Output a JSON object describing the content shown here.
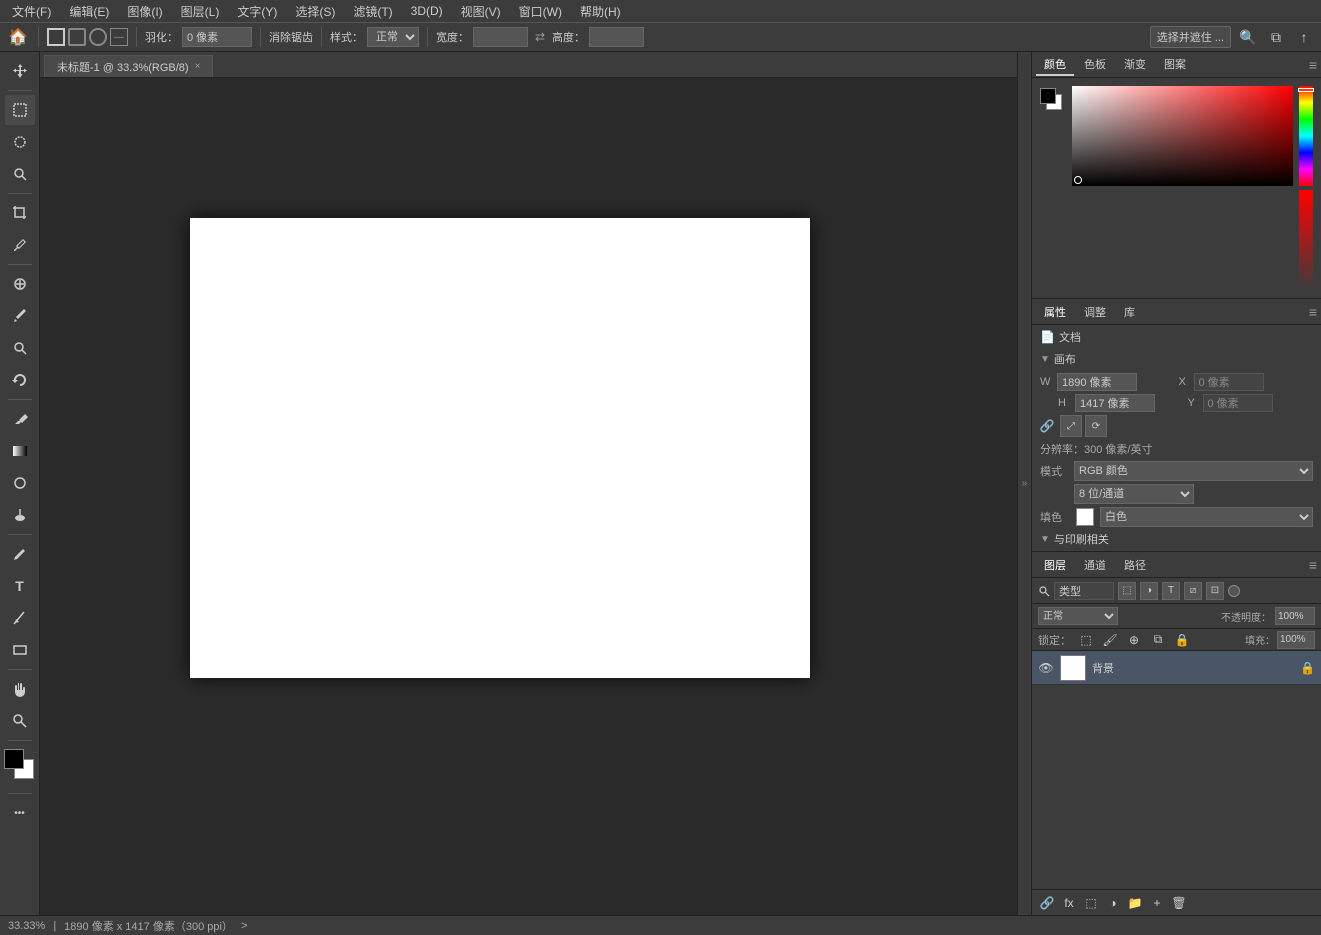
{
  "menubar": {
    "items": [
      "文件(F)",
      "编辑(E)",
      "图像(I)",
      "图层(L)",
      "文字(Y)",
      "选择(S)",
      "滤镜(T)",
      "3D(D)",
      "视图(V)",
      "窗口(W)",
      "帮助(H)"
    ]
  },
  "optionsbar": {
    "feather_label": "羽化：",
    "feather_value": "0 像素",
    "antialiasing_label": "消除锯齿",
    "style_label": "样式：",
    "style_value": "正常",
    "width_label": "宽度：",
    "height_label": "高度：",
    "select_subject_label": "选择并遮住 ...",
    "tool_preset_icon": "tool-preset",
    "zoom_icon": "zoom",
    "arrange_icon": "arrange",
    "share_icon": "share"
  },
  "tab": {
    "title": "未标题-1 @ 33.3%(RGB/8)",
    "close": "×"
  },
  "tools": [
    {
      "name": "move",
      "icon": "⊹",
      "label": "移动工具"
    },
    {
      "name": "marquee-rect",
      "icon": "⬚",
      "label": "矩形选框工具"
    },
    {
      "name": "lasso",
      "icon": "○",
      "label": "套索工具"
    },
    {
      "name": "quick-select",
      "icon": "⊕",
      "label": "快速选择工具"
    },
    {
      "name": "crop",
      "icon": "⊞",
      "label": "裁剪工具"
    },
    {
      "name": "eyedropper",
      "icon": "✒",
      "label": "吸管工具"
    },
    {
      "name": "heal",
      "icon": "⊕",
      "label": "修复画笔工具"
    },
    {
      "name": "brush",
      "icon": "⌀",
      "label": "画笔工具"
    },
    {
      "name": "clone",
      "icon": "⊜",
      "label": "仿制图章工具"
    },
    {
      "name": "history-brush",
      "icon": "↺",
      "label": "历史记录画笔工具"
    },
    {
      "name": "eraser",
      "icon": "◻",
      "label": "橡皮擦工具"
    },
    {
      "name": "gradient",
      "icon": "▣",
      "label": "渐变工具"
    },
    {
      "name": "blur",
      "icon": "◎",
      "label": "模糊工具"
    },
    {
      "name": "dodge",
      "icon": "⬤",
      "label": "加深工具"
    },
    {
      "name": "pen",
      "icon": "✎",
      "label": "钢笔工具"
    },
    {
      "name": "type",
      "icon": "T",
      "label": "文字工具"
    },
    {
      "name": "path-select",
      "icon": "↗",
      "label": "路径选择工具"
    },
    {
      "name": "shape",
      "icon": "▭",
      "label": "矩形工具"
    },
    {
      "name": "hand",
      "icon": "✋",
      "label": "手形工具"
    },
    {
      "name": "zoom",
      "icon": "⌕",
      "label": "缩放工具"
    },
    {
      "name": "extra",
      "icon": "…",
      "label": "更多工具"
    }
  ],
  "colorpanel": {
    "tabs": [
      "颜色",
      "色板",
      "渐变",
      "图案"
    ],
    "active_tab": "颜色"
  },
  "propertiespanel": {
    "tabs": [
      "属性",
      "调整",
      "库"
    ],
    "active_tab": "属性",
    "doc_label": "文档",
    "canvas_section": "画布",
    "width_label": "W",
    "width_value": "1890 像素",
    "height_label": "H",
    "height_value": "1417 像素",
    "x_label": "X",
    "x_value": "0 像素",
    "y_label": "Y",
    "y_value": "0 像素",
    "resolution_label": "分辨率：300 像素/英寸",
    "mode_label": "模式",
    "mode_value": "RGB 颜色",
    "bitdepth_value": "8 位/通道",
    "fill_label": "填色",
    "fill_color": "白色",
    "guide_section": "与印刷相关"
  },
  "layerspanel": {
    "tabs": [
      "图层",
      "通道",
      "路径"
    ],
    "active_tab": "图层",
    "search_placeholder": "类型",
    "mode_value": "正常",
    "opacity_label": "不透明度：",
    "opacity_value": "100%",
    "lock_label": "锁定：",
    "fill_label": "填充：",
    "fill_value": "100%",
    "layers": [
      {
        "name": "背景",
        "visible": true,
        "locked": true,
        "thumb_bg": "white"
      }
    ]
  },
  "statusbar": {
    "zoom": "33.33%",
    "size": "1890 像素 x 1417 像素（300 ppi）",
    "extra": ">"
  },
  "colors": {
    "bg": "#2b2b2b",
    "panel": "#3c3c3c",
    "dark": "#222",
    "accent": "#4a4a4a",
    "border": "#555"
  }
}
